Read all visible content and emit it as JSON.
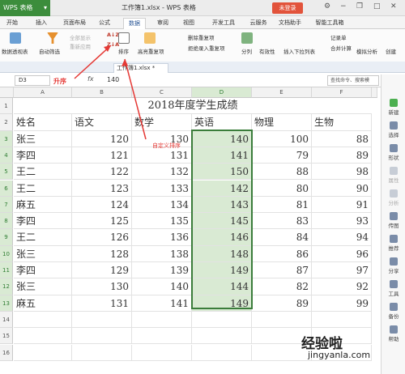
{
  "title_bar": {
    "app_name": "WPS 表格",
    "window_title": "工作簿1.xlsx - WPS 表格",
    "login_label": "未登录"
  },
  "ribbon_tabs": [
    "开始",
    "插入",
    "页面布局",
    "公式",
    "数据",
    "审阅",
    "视图",
    "开发工具",
    "云服务",
    "文档助手",
    "智能工具箱"
  ],
  "active_tab": "数据",
  "ribbon": {
    "pivot": "数据透视表",
    "autofilter": "自动筛选",
    "show_all": "全部显示",
    "reapply": "重新应用",
    "sort_asc_icon": "A↓Z",
    "sort_desc_icon": "Z↓A",
    "sort": "排序",
    "highlight_dup": "高亮重复项",
    "remove_dup": "删除重复项",
    "reject_dup": "拒绝录入重复项",
    "split": "分列",
    "validity": "有效性",
    "insert_dropdown": "插入下拉列表",
    "record": "记录单",
    "consolidate": "合并计算",
    "simulate": "模拟分析",
    "create_group": "创建"
  },
  "doc_tab": "工作簿1.xlsx *",
  "formula_bar": {
    "name_box": "D3",
    "fx": "fx",
    "value": "140",
    "search": "查找命令、搜索模"
  },
  "annotations": {
    "ascending": "升序",
    "custom_sort": "自定义排序"
  },
  "columns": [
    "A",
    "B",
    "C",
    "D",
    "E",
    "F"
  ],
  "row_numbers": [
    "1",
    "2",
    "3",
    "4",
    "5",
    "6",
    "7",
    "8",
    "9",
    "10",
    "11",
    "12",
    "13",
    "14",
    "15",
    "16"
  ],
  "sheet_title": "2018年度学生成绩",
  "headers": [
    "姓名",
    "语文",
    "数学",
    "英语",
    "物理",
    "生物"
  ],
  "rows": [
    [
      "张三",
      "120",
      "130",
      "140",
      "100",
      "88"
    ],
    [
      "李四",
      "121",
      "131",
      "141",
      "79",
      "89"
    ],
    [
      "王二",
      "122",
      "132",
      "150",
      "88",
      "98"
    ],
    [
      "王二",
      "123",
      "133",
      "142",
      "80",
      "90"
    ],
    [
      "麻五",
      "124",
      "134",
      "143",
      "81",
      "91"
    ],
    [
      "李四",
      "125",
      "135",
      "145",
      "83",
      "93"
    ],
    [
      "王二",
      "126",
      "136",
      "146",
      "84",
      "94"
    ],
    [
      "张三",
      "128",
      "138",
      "148",
      "86",
      "96"
    ],
    [
      "李四",
      "129",
      "139",
      "149",
      "87",
      "97"
    ],
    [
      "张三",
      "130",
      "140",
      "144",
      "82",
      "92"
    ],
    [
      "麻五",
      "131",
      "141",
      "149",
      "89",
      "99"
    ]
  ],
  "side_panel": [
    "新建",
    "选择",
    "形状",
    "属性",
    "分析",
    "传图",
    "推荐",
    "分享",
    "工具",
    "备份",
    "帮助"
  ],
  "watermark": {
    "line1": "经验啦",
    "line2": "jingyanla.com"
  },
  "colors": {
    "selection": "#3b7d3b",
    "selection_fill": "#d9ead3",
    "annotation": "#e53935",
    "app_green": "#3c8d3c"
  }
}
